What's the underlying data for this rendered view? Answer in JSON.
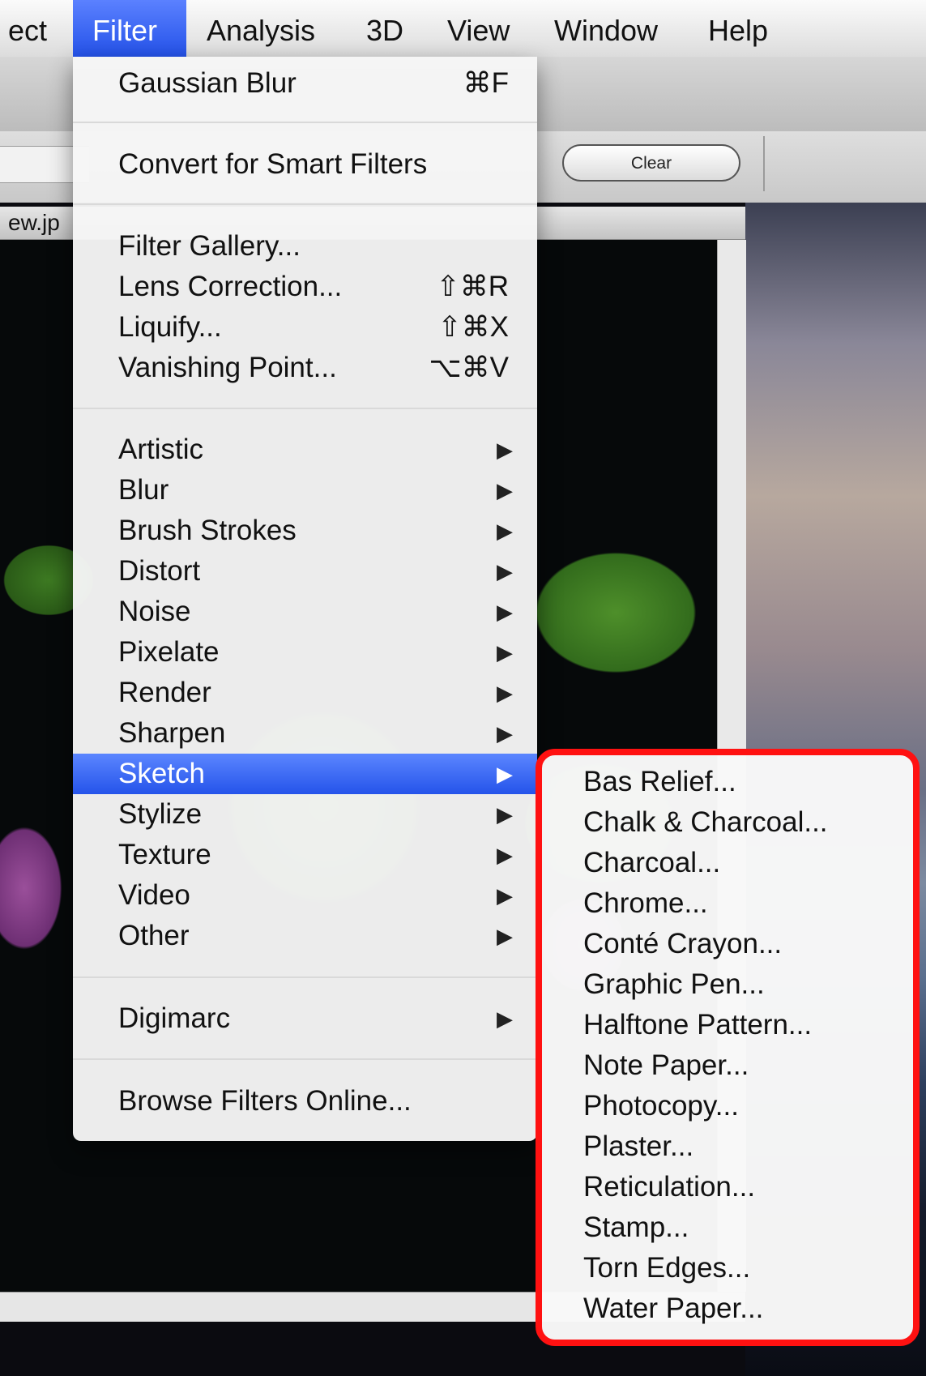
{
  "menubar": {
    "items": [
      "ect",
      "Filter",
      "Analysis",
      "3D",
      "View",
      "Window",
      "Help"
    ]
  },
  "toolbar": {
    "clear_label": "Clear"
  },
  "document": {
    "title_fragment": "ew.jp"
  },
  "filter_menu": {
    "gaussian_blur": {
      "label": "Gaussian Blur",
      "shortcut": "⌘F"
    },
    "convert_smart": {
      "label": "Convert for Smart Filters"
    },
    "filter_gallery": {
      "label": "Filter Gallery..."
    },
    "lens_correction": {
      "label": "Lens Correction...",
      "shortcut": "⇧⌘R"
    },
    "liquify": {
      "label": "Liquify...",
      "shortcut": "⇧⌘X"
    },
    "vanishing_point": {
      "label": "Vanishing Point...",
      "shortcut": "⌥⌘V"
    },
    "submenus": [
      "Artistic",
      "Blur",
      "Brush Strokes",
      "Distort",
      "Noise",
      "Pixelate",
      "Render",
      "Sharpen",
      "Sketch",
      "Stylize",
      "Texture",
      "Video",
      "Other"
    ],
    "selected": "Sketch",
    "digimarc": {
      "label": "Digimarc"
    },
    "browse_online": {
      "label": "Browse Filters Online..."
    },
    "arrow_glyph": "▶"
  },
  "sketch_submenu": {
    "items": [
      "Bas Relief...",
      "Chalk & Charcoal...",
      "Charcoal...",
      "Chrome...",
      "Conté Crayon...",
      "Graphic Pen...",
      "Halftone Pattern...",
      "Note Paper...",
      "Photocopy...",
      "Plaster...",
      "Reticulation...",
      "Stamp...",
      "Torn Edges...",
      "Water Paper..."
    ],
    "highlight_color": "#ff1111"
  }
}
